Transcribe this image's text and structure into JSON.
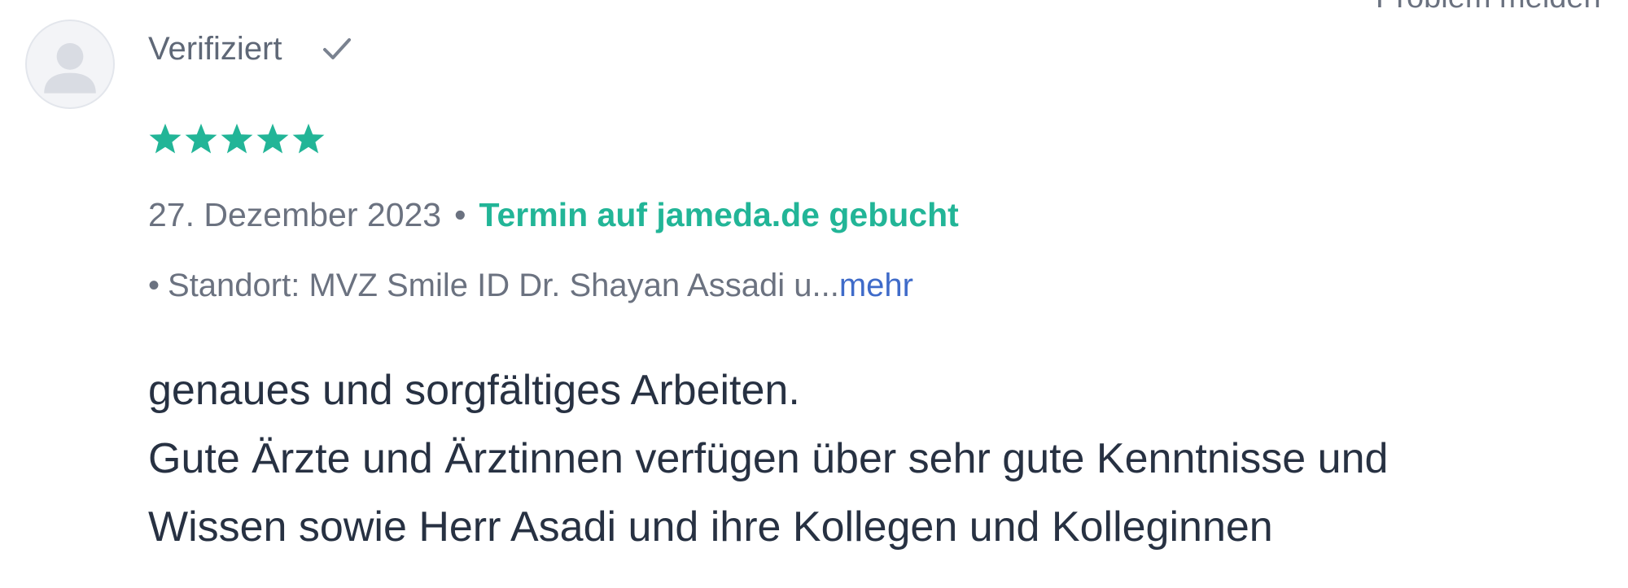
{
  "report": {
    "label": "Problem melden"
  },
  "reviewer": {
    "avatar_icon": "user-avatar-icon",
    "verified_label": "Verifiziert",
    "verified_icon": "checkmark-icon"
  },
  "rating": {
    "stars": 5,
    "max": 5,
    "color": "#22b597"
  },
  "meta": {
    "date": "27. Dezember 2023",
    "separator": "•",
    "booked_label": "Termin auf jameda.de gebucht"
  },
  "location": {
    "bullet": "•",
    "text": "Standort: MVZ Smile ID Dr. Shayan Assadi u...",
    "more_label": "mehr"
  },
  "review": {
    "lines": [
      "genaues und sorgfältiges Arbeiten.",
      "Gute Ärzte und Ärztinnen verfügen über sehr gute Kenntnisse und",
      "Wissen sowie Herr Asadi und ihre Kollegen und Kolleginnen"
    ]
  },
  "colors": {
    "accent": "#22b597",
    "link": "#3f6bc9",
    "muted": "#6b7280",
    "text": "#273142"
  }
}
